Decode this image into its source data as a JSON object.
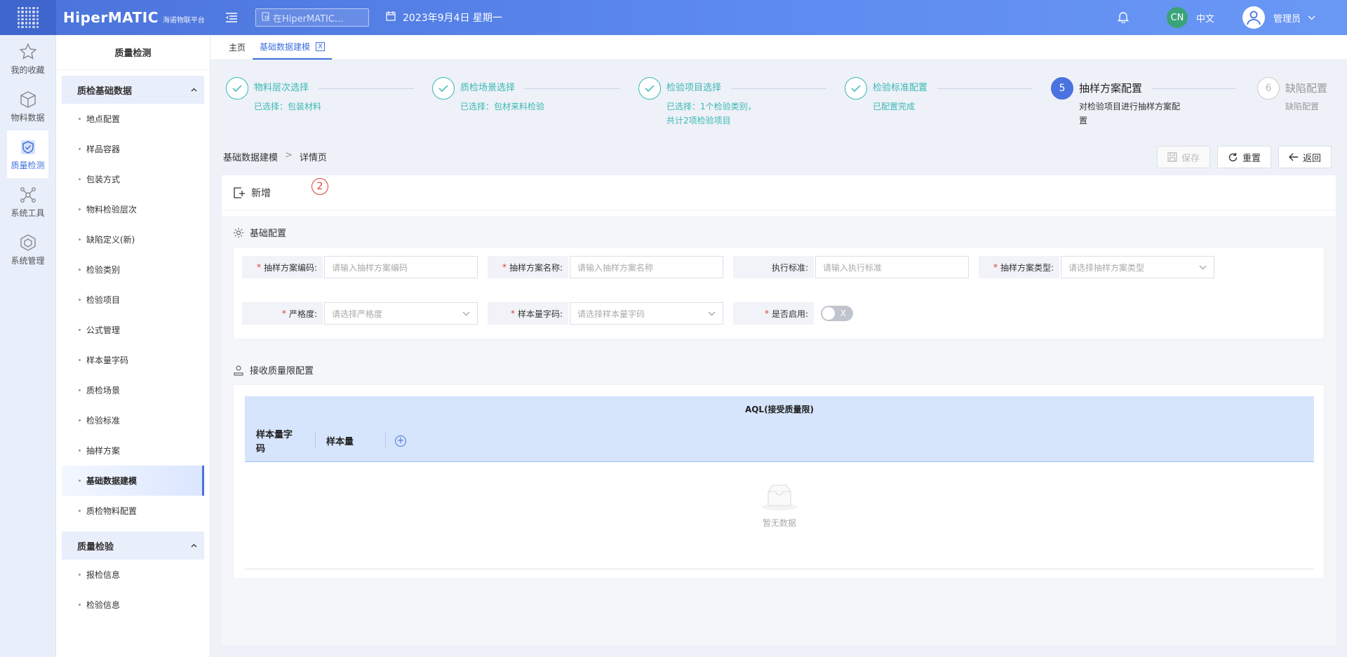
{
  "topbar": {
    "brand": "HiperMATIC",
    "brand_sub": "海诺物联平台",
    "search_placeholder": "在HiperMATIC...",
    "date": "2023年9月4日 星期一",
    "lang_badge": "CN",
    "lang_label": "中文",
    "user_name": "管理员"
  },
  "rail": [
    {
      "label": "我的收藏",
      "icon": "star-icon"
    },
    {
      "label": "物料数据",
      "icon": "cube-icon"
    },
    {
      "label": "质量检测",
      "icon": "shield-check-icon",
      "active": true
    },
    {
      "label": "系统工具",
      "icon": "network-icon"
    },
    {
      "label": "系统管理",
      "icon": "hexagon-icon"
    }
  ],
  "submenu": {
    "title": "质量检测",
    "group1": "质检基础数据",
    "group1_items": [
      "地点配置",
      "样品容器",
      "包装方式",
      "物料检验层次",
      "缺陷定义(新)",
      "检验类别",
      "检验项目",
      "公式管理",
      "样本量字码",
      "质检场景",
      "检验标准",
      "抽样方案",
      "基础数据建模",
      "质检物料配置"
    ],
    "group2": "质量检验",
    "group2_items": [
      "报检信息",
      "检验信息"
    ]
  },
  "tabs": {
    "home": "主页",
    "current": "基础数据建模",
    "close": "X"
  },
  "steps": [
    {
      "title": "物料层次选择",
      "desc": "已选择：包装材料",
      "state": "done"
    },
    {
      "title": "质检场景选择",
      "desc": "已选择：包材来料检验",
      "state": "done"
    },
    {
      "title": "检验项目选择",
      "desc": "已选择：1个检验类别，共计2项检验项目",
      "state": "done"
    },
    {
      "title": "检验标准配置",
      "desc": "已配置完成",
      "state": "done"
    },
    {
      "num": "5",
      "title": "抽样方案配置",
      "desc": "对检验项目进行抽样方案配置",
      "state": "current"
    },
    {
      "num": "6",
      "title": "缺陷配置",
      "desc": "缺陷配置",
      "state": "pending"
    }
  ],
  "breadcrumb": {
    "parent": "基础数据建模",
    "sep": ">",
    "current": "详情页"
  },
  "actions": {
    "save": "保存",
    "reset": "重置",
    "back": "返回"
  },
  "add_label": "新增",
  "marker": "2",
  "basic_config": {
    "title": "基础配置",
    "fields": {
      "code": {
        "label": "抽样方案编码:",
        "placeholder": "请输入抽样方案编码",
        "required": true
      },
      "name": {
        "label": "抽样方案名称:",
        "placeholder": "请输入抽样方案名称",
        "required": true
      },
      "standard": {
        "label": "执行标准:",
        "placeholder": "请输入执行标准",
        "required": false
      },
      "type": {
        "label": "抽样方案类型:",
        "placeholder": "请选择抽样方案类型",
        "required": true
      },
      "severity": {
        "label": "严格度:",
        "placeholder": "请选择严格度",
        "required": true
      },
      "sample_code": {
        "label": "样本量字码:",
        "placeholder": "请选择样本量字码",
        "required": true
      },
      "enabled": {
        "label": "是否启用:",
        "value": "X",
        "required": true
      }
    }
  },
  "aql_config": {
    "title": "接收质量限配置",
    "header": "AQL(接受质量限)",
    "col1": "样本量字码",
    "col2": "样本量",
    "empty": "暂无数据"
  }
}
